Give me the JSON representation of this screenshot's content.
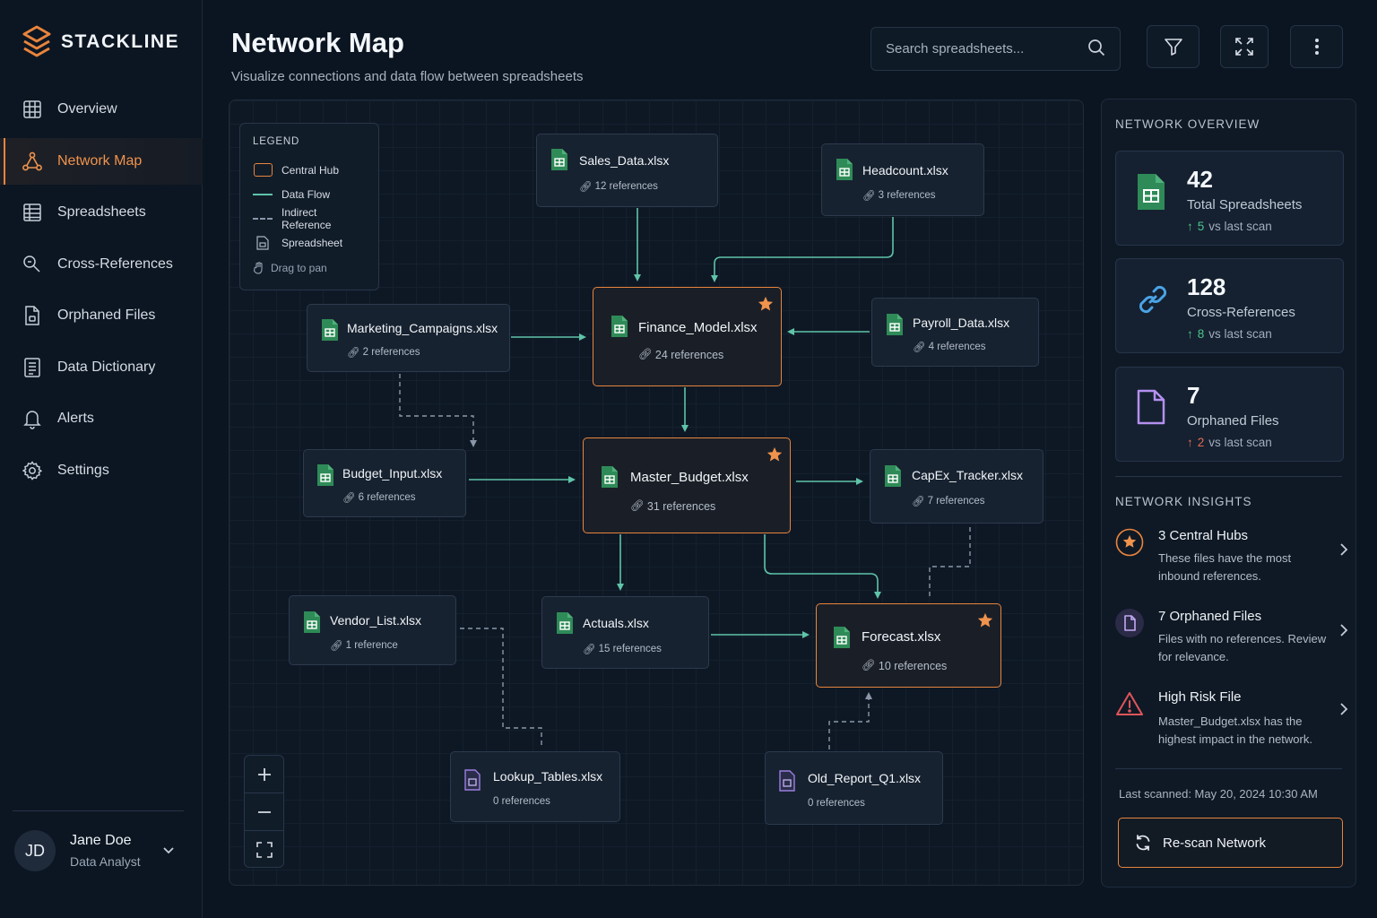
{
  "brand": {
    "name": "STACKLINE"
  },
  "colors": {
    "accent": "#e8843d",
    "flow": "#5fc4a8",
    "indirect": "#8a97a8",
    "sheet_green": "#2e8b57",
    "orphan": "#9b7ee0",
    "danger": "#e0555a",
    "up_green": "#4cc48b",
    "up_red": "#e46a55"
  },
  "sidebar": {
    "items": [
      {
        "label": "Overview",
        "icon": "grid-icon",
        "active": false
      },
      {
        "label": "Network Map",
        "icon": "network-icon",
        "active": true
      },
      {
        "label": "Spreadsheets",
        "icon": "table-icon",
        "active": false
      },
      {
        "label": "Cross-References",
        "icon": "link-search-icon",
        "active": false
      },
      {
        "label": "Orphaned Files",
        "icon": "file-icon",
        "active": false
      },
      {
        "label": "Data Dictionary",
        "icon": "book-icon",
        "active": false
      },
      {
        "label": "Alerts",
        "icon": "bell-icon",
        "active": false
      },
      {
        "label": "Settings",
        "icon": "gear-icon",
        "active": false
      }
    ],
    "user": {
      "initials": "JD",
      "name": "Jane Doe",
      "role": "Data Analyst"
    }
  },
  "header": {
    "title": "Network Map",
    "subtitle": "Visualize connections and data flow between spreadsheets",
    "search_placeholder": "Search spreadsheets..."
  },
  "legend": {
    "title": "LEGEND",
    "items": [
      "Central Hub",
      "Data Flow",
      "Indirect Reference",
      "Spreadsheet"
    ],
    "hint": "Drag to pan"
  },
  "nodes": [
    {
      "name": "Sales_Data.xlsx",
      "refs": "12 references"
    },
    {
      "name": "Headcount.xlsx",
      "refs": "3 references"
    },
    {
      "name": "Marketing_Campaigns.xlsx",
      "refs": "2 references"
    },
    {
      "name": "Finance_Model.xlsx",
      "refs": "24 references",
      "hub": true
    },
    {
      "name": "Payroll_Data.xlsx",
      "refs": "4 references"
    },
    {
      "name": "Budget_Input.xlsx",
      "refs": "6 references"
    },
    {
      "name": "Master_Budget.xlsx",
      "refs": "31 references",
      "hub": true
    },
    {
      "name": "CapEx_Tracker.xlsx",
      "refs": "7 references"
    },
    {
      "name": "Vendor_List.xlsx",
      "refs": "1 reference"
    },
    {
      "name": "Actuals.xlsx",
      "refs": "15 references"
    },
    {
      "name": "Forecast.xlsx",
      "refs": "10 references",
      "hub": true
    },
    {
      "name": "Lookup_Tables.xlsx",
      "refs": "0 references",
      "orphan": true
    },
    {
      "name": "Old_Report_Q1.xlsx",
      "refs": "0 references",
      "orphan": true
    }
  ],
  "panel": {
    "overview_title": "NETWORK OVERVIEW",
    "stats": [
      {
        "value": "42",
        "label": "Total Spreadsheets",
        "delta": "5",
        "delta_suffix": "vs last scan",
        "direction": "up-green"
      },
      {
        "value": "128",
        "label": "Cross-References",
        "delta": "8",
        "delta_suffix": "vs last scan",
        "direction": "up-green"
      },
      {
        "value": "7",
        "label": "Orphaned Files",
        "delta": "2",
        "delta_suffix": "vs last scan",
        "direction": "up-red"
      }
    ],
    "insights_title": "NETWORK INSIGHTS",
    "insights": [
      {
        "title": "3 Central Hubs",
        "desc": "These files have the most inbound references."
      },
      {
        "title": "7 Orphaned Files",
        "desc": "Files with no references. Review for relevance."
      },
      {
        "title": "High Risk File",
        "desc": "Master_Budget.xlsx has the highest impact in the network."
      }
    ],
    "last_scanned": "Last scanned: May 20, 2024 10:30 AM",
    "rescan_label": "Re-scan Network"
  }
}
